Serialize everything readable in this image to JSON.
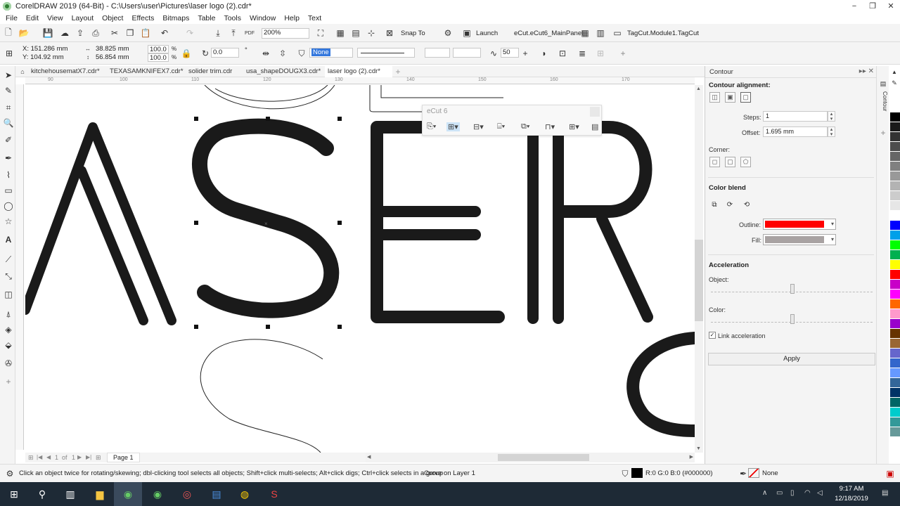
{
  "window": {
    "title": "CorelDRAW 2019 (64-Bit) - C:\\Users\\user\\Pictures\\laser logo (2).cdr*",
    "controls": [
      "−",
      "❐",
      "✕"
    ]
  },
  "menu": [
    "File",
    "Edit",
    "View",
    "Layout",
    "Object",
    "Effects",
    "Bitmaps",
    "Table",
    "Tools",
    "Window",
    "Help",
    "Text"
  ],
  "toolbar": {
    "zoom": "200%",
    "snap_to": "Snap To",
    "launch": "Launch",
    "panel1": "eCut.eCut6_MainPanel",
    "panel2": "TagCut.Module1.TagCut"
  },
  "propbar": {
    "x": "X: 151.286 mm",
    "y": "Y: 104.92 mm",
    "w": "38.825 mm",
    "h": "56.854 mm",
    "scale_w": "100.0",
    "scale_h": "100.0",
    "pct": "%",
    "angle": "0.0",
    "deg": "°",
    "fill": "None",
    "nodes": "50"
  },
  "tabs": [
    {
      "label": "kitchehousematX7.cdr*"
    },
    {
      "label": "TEXASAMKNIFEX7.cdr*"
    },
    {
      "label": "solider trim.cdr"
    },
    {
      "label": "usa_shapeDOUGX3.cdr*"
    },
    {
      "label": "laser logo (2).cdr*"
    }
  ],
  "ruler_ticks": [
    "90",
    "100",
    "110",
    "120",
    "130",
    "140",
    "150",
    "160",
    "170",
    "180",
    "190"
  ],
  "ecut": {
    "title": "eCut 6"
  },
  "pager": {
    "page": "1",
    "of": "of",
    "total": "1",
    "page_tab": "Page 1"
  },
  "docker": {
    "title": "Contour",
    "alignment_label": "Contour alignment:",
    "steps_label": "Steps:",
    "steps_value": "1",
    "offset_label": "Offset:",
    "offset_value": "1.695 mm",
    "corner_label": "Corner:",
    "color_blend_label": "Color blend",
    "outline_label": "Outline:",
    "fill_label": "Fill:",
    "outline_color": "#ff0000",
    "fill_color": "#a8a2a2",
    "acceleration_label": "Acceleration",
    "object_label": "Object:",
    "color_label": "Color:",
    "link_label": "Link acceleration",
    "apply_label": "Apply",
    "side_tab": "Contour"
  },
  "palette": [
    "#ffffff",
    "#000000",
    "#1a1a1a",
    "#333333",
    "#4d4d4d",
    "#666666",
    "#808080",
    "#999999",
    "#b3b3b3",
    "#cccccc",
    "#e6e6e6",
    "#ffffff",
    "#0000ff",
    "#00a0e9",
    "#00ff00",
    "#00b050",
    "#ffff00",
    "#ff0000",
    "#c800c8",
    "#ff00ff",
    "#ff6600",
    "#ff99cc",
    "#9900cc",
    "#663300",
    "#996633",
    "#6666cc",
    "#3366cc",
    "#6699ff",
    "#336699",
    "#003366",
    "#006666",
    "#00cccc",
    "#339999",
    "#669999"
  ],
  "status": {
    "hint": "Click an object twice for rotating/skewing; dbl-clicking tool selects all objects; Shift+click multi-selects; Alt+click digs; Ctrl+click selects in a group",
    "layer": "Curve on Layer 1",
    "fill_rgb": "R:0 G:0 B:0 (#000000)",
    "outline": "None"
  },
  "taskbar": {
    "time": "9:17 AM",
    "date": "12/18/2019"
  }
}
